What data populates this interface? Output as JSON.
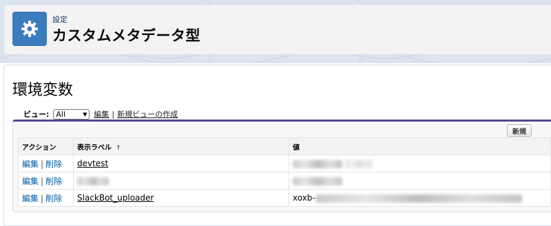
{
  "header": {
    "subtitle": "設定",
    "title": "カスタムメタデータ型",
    "icon": "gear-icon"
  },
  "page": {
    "title": "環境変数"
  },
  "view": {
    "label": "ビュー:",
    "selected": "All",
    "edit_link": "編集",
    "separator": "|",
    "new_view_link": "新規ビューの作成"
  },
  "toolbar": {
    "new_button": "新規"
  },
  "table": {
    "headers": {
      "action": "アクション",
      "label": "表示ラベル",
      "sort_indicator": "↑",
      "value": "値"
    },
    "action_edit": "編集",
    "action_delete": "削除",
    "action_separator": "|",
    "rows": [
      {
        "label": "devtest",
        "value": ""
      },
      {
        "label": "",
        "value": ""
      },
      {
        "label": "SlackBot_uploader",
        "value": "xoxb-"
      }
    ]
  },
  "colors": {
    "header_icon_bg": "#3c7cbc",
    "list_top_border": "#56458c",
    "link": "#015ba7"
  }
}
